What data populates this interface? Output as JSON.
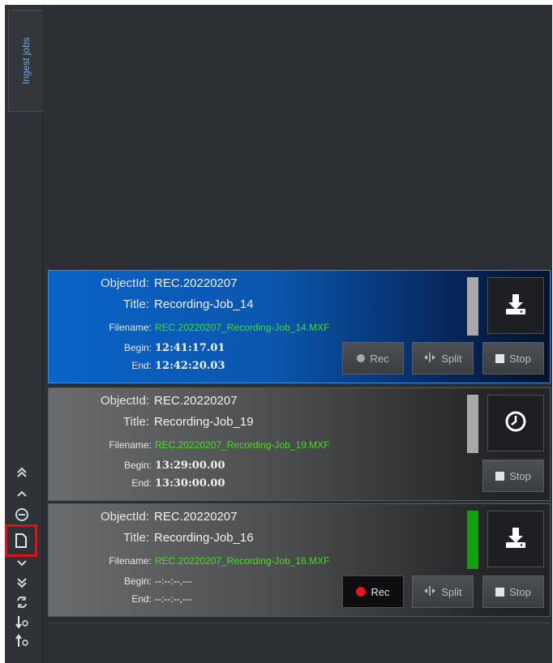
{
  "sidebar": {
    "tab_label": "Ingest jobs",
    "icons": [
      "double-chevron-up-icon",
      "chevron-up-icon",
      "minus-circle-icon",
      "new-document-icon",
      "chevron-down-icon",
      "double-chevron-down-icon",
      "refresh-icon",
      "sort-down-clock-icon",
      "sort-up-clock-icon"
    ]
  },
  "labels": {
    "object_id": "ObjectId:",
    "title": "Title:",
    "filename": "Filename:",
    "begin": "Begin:",
    "end": "End:"
  },
  "buttons": {
    "rec": "Rec",
    "split": "Split",
    "stop": "Stop"
  },
  "jobs": [
    {
      "object_id": "REC.20220207",
      "title": "Recording-Job_14",
      "filename": "REC.20220207_Recording-Job_14.MXF",
      "begin": "12:41:17.01",
      "end": "12:42:20.03",
      "status_color": "#a9a9a9",
      "action_icon": "download-icon"
    },
    {
      "object_id": "REC.20220207",
      "title": "Recording-Job_19",
      "filename": "REC.20220207_Recording-Job_19.MXF",
      "begin": "13:29:00.00",
      "end": "13:30:00.00",
      "status_color": "#a9a9a9",
      "action_icon": "clock-icon"
    },
    {
      "object_id": "REC.20220207",
      "title": "Recording-Job_16",
      "filename": "REC.20220207_Recording-Job_16.MXF",
      "begin": "--:--:--,---",
      "end": "--:--:--,---",
      "status_color": "#12a012",
      "action_icon": "download-icon"
    }
  ]
}
